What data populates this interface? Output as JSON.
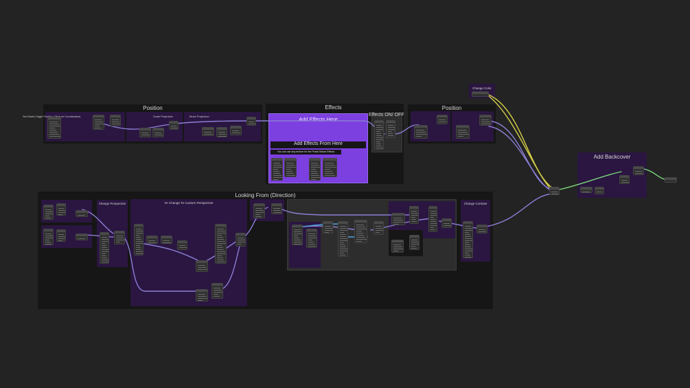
{
  "frames": {
    "position_left": "Position",
    "effects": "Effects",
    "effects_on_off": "Effects ON/ OFF",
    "position_right": "Position",
    "add_backcover": "Add Backcover",
    "looking_from": "Looking From (Direction)",
    "add_effects_here": "Add Effects Here",
    "add_effects_from_here": "Add Effects From Here",
    "effects_note": "You can use any texture for the Portal Distort Effects",
    "change_color": "Change Color",
    "change_perspective": "Change Perspective",
    "custom_perspective": "Or Change To Custom Perspective",
    "change_contrast": "Change Contrast",
    "scale_projection": "Scale Projection",
    "move_projection": "Move Projection",
    "set_world_origin": "Set World Origin Position (Texture Coordinates)"
  },
  "colors": {
    "background": "#232323",
    "frame_dark": "#161616",
    "frame_purple": "#2a1640",
    "frame_violet": "#7c3fe0",
    "wire_purple": "#8b7fd6",
    "wire_green": "#7bd87b",
    "wire_yellow": "#d9d24a",
    "wire_blue": "#4fa6e0"
  }
}
